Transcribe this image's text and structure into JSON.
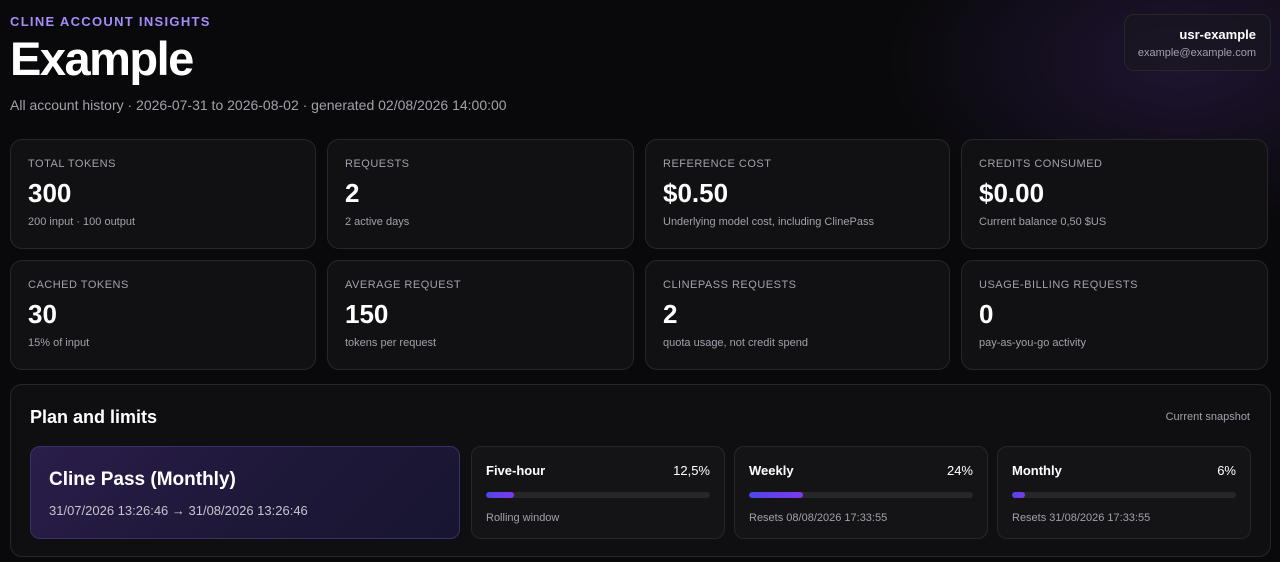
{
  "header": {
    "eyebrow": "CLINE ACCOUNT INSIGHTS",
    "title": "Example",
    "subtitle": "All account history · 2026-07-31 to 2026-08-02 · generated 02/08/2026 14:00:00"
  },
  "user": {
    "name": "usr-example",
    "email": "example@example.com"
  },
  "stats": [
    {
      "label": "TOTAL TOKENS",
      "value": "300",
      "note": "200 input · 100 output"
    },
    {
      "label": "REQUESTS",
      "value": "2",
      "note": "2 active days"
    },
    {
      "label": "REFERENCE COST",
      "value": "$0.50",
      "note": "Underlying model cost, including ClinePass"
    },
    {
      "label": "CREDITS CONSUMED",
      "value": "$0.00",
      "note": "Current balance 0,50 $US"
    },
    {
      "label": "CACHED TOKENS",
      "value": "30",
      "note": "15% of input"
    },
    {
      "label": "AVERAGE REQUEST",
      "value": "150",
      "note": "tokens per request"
    },
    {
      "label": "CLINEPASS REQUESTS",
      "value": "2",
      "note": "quota usage, not credit spend"
    },
    {
      "label": "USAGE-BILLING REQUESTS",
      "value": "0",
      "note": "pay-as-you-go activity"
    }
  ],
  "plan": {
    "title": "Plan and limits",
    "snapshot": "Current snapshot",
    "name": "Cline Pass (Monthly)",
    "dates": "31/07/2026 13:26:46 → 31/08/2026 13:26:46",
    "limits": [
      {
        "name": "Five-hour",
        "percent_label": "12,5%",
        "fraction": 0.125,
        "note": "Rolling window"
      },
      {
        "name": "Weekly",
        "percent_label": "24%",
        "fraction": 0.24,
        "note": "Resets 08/08/2026 17:33:55"
      },
      {
        "name": "Monthly",
        "percent_label": "6%",
        "fraction": 0.06,
        "note": "Resets 31/08/2026 17:33:55"
      }
    ]
  },
  "colors": {
    "accent": "#a78bfa",
    "bar_start": "#4f46e5",
    "bar_end": "#7c3aed"
  }
}
